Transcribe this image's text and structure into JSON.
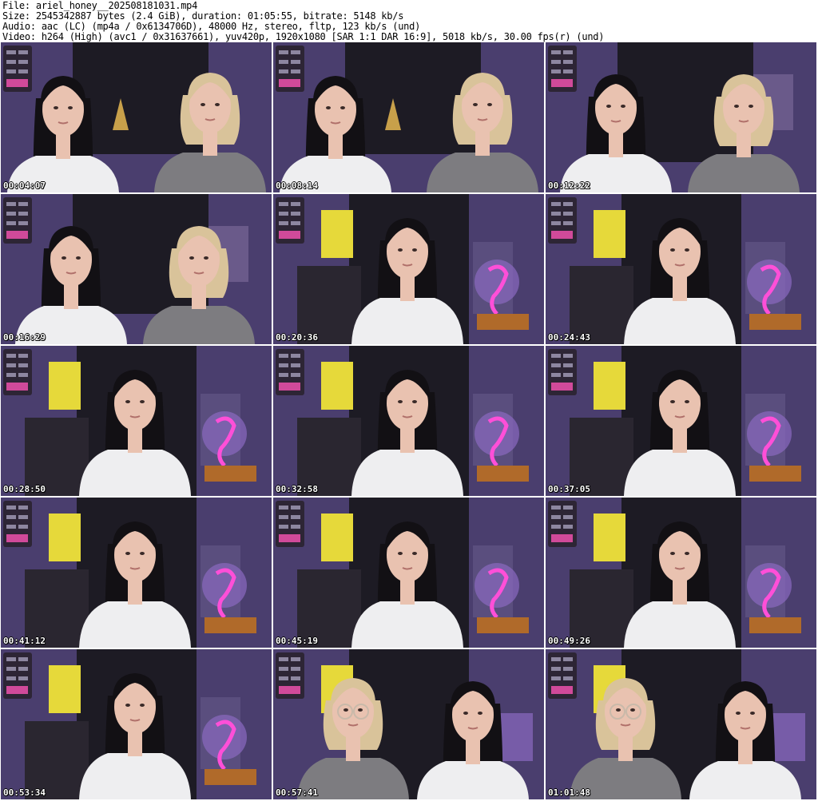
{
  "header": {
    "file_line": "File: ariel_honey__202508181031.mp4",
    "size_line": "Size: 2545342887 bytes (2.4 GiB), duration: 01:05:55, bitrate: 5148 kb/s",
    "audio_line": "Audio: aac (LC) (mp4a / 0x6134706D), 48000 Hz, stereo, fltp, 123 kb/s (und)",
    "video_line": "Video: h264 (High) (avc1 / 0x31637661), yuv420p, 1920x1080 [SAR 1:1 DAR 16:9], 5018 kb/s, 30.00 fps(r) (und)"
  },
  "thumbnails": [
    {
      "timestamp": "00:04:07",
      "scene": "duo-a"
    },
    {
      "timestamp": "00:08:14",
      "scene": "duo-a"
    },
    {
      "timestamp": "00:12:22",
      "scene": "duo-b"
    },
    {
      "timestamp": "00:16:29",
      "scene": "duo-b"
    },
    {
      "timestamp": "00:20:36",
      "scene": "solo"
    },
    {
      "timestamp": "00:24:43",
      "scene": "solo"
    },
    {
      "timestamp": "00:28:50",
      "scene": "solo"
    },
    {
      "timestamp": "00:32:58",
      "scene": "solo"
    },
    {
      "timestamp": "00:37:05",
      "scene": "solo"
    },
    {
      "timestamp": "00:41:12",
      "scene": "solo"
    },
    {
      "timestamp": "00:45:19",
      "scene": "solo"
    },
    {
      "timestamp": "00:49:26",
      "scene": "solo"
    },
    {
      "timestamp": "00:53:34",
      "scene": "solo"
    },
    {
      "timestamp": "00:57:41",
      "scene": "duo-c"
    },
    {
      "timestamp": "01:01:48",
      "scene": "duo-c"
    }
  ],
  "colors": {
    "background": "#ffffff",
    "header_text": "#000000",
    "timestamp_text": "#ffffff",
    "timestamp_outline": "#000000",
    "wall_dark": "#1d1b24",
    "wall_purple": "#4a3e6e",
    "lamp_yellow": "#e6d93a",
    "neon_pink": "#ff4fd8",
    "hair_dark": "#121014",
    "hair_blonde": "#d9c39a",
    "skin": "#e9c2b0",
    "shirt_white": "#eeeef0",
    "top_grey": "#7d7c80"
  }
}
